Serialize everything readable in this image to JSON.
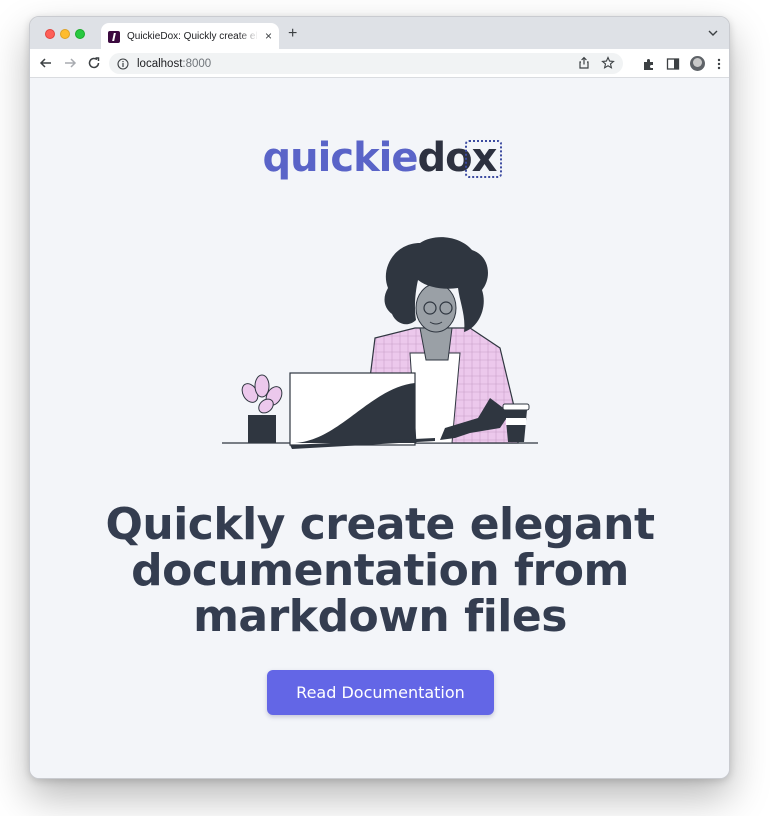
{
  "browser": {
    "tab": {
      "title": "QuickieDox: Quickly create elegant documentation from markdown files",
      "close_glyph": "×"
    },
    "new_tab_glyph": "+",
    "address_bar": {
      "host": "localhost",
      "port": ":8000"
    },
    "icons": [
      "back-arrow-icon",
      "forward-arrow-icon",
      "reload-icon",
      "info-icon",
      "share-icon",
      "star-icon",
      "extensions-icon",
      "side-panel-icon",
      "profile-avatar",
      "kebab-menu-icon",
      "tab-search-icon"
    ]
  },
  "page": {
    "logo": {
      "part1": "quickie",
      "part2": "dox"
    },
    "headline": "Quickly create elegant documentation from markdown files",
    "cta_label": "Read Documentation"
  },
  "colors": {
    "logo_primary": "#5a64c8",
    "logo_secondary": "#2d3140",
    "headline": "#343d50",
    "button": "#6366e6",
    "page_bg": "#f3f5f9",
    "jacket": "#ecc8ec"
  }
}
